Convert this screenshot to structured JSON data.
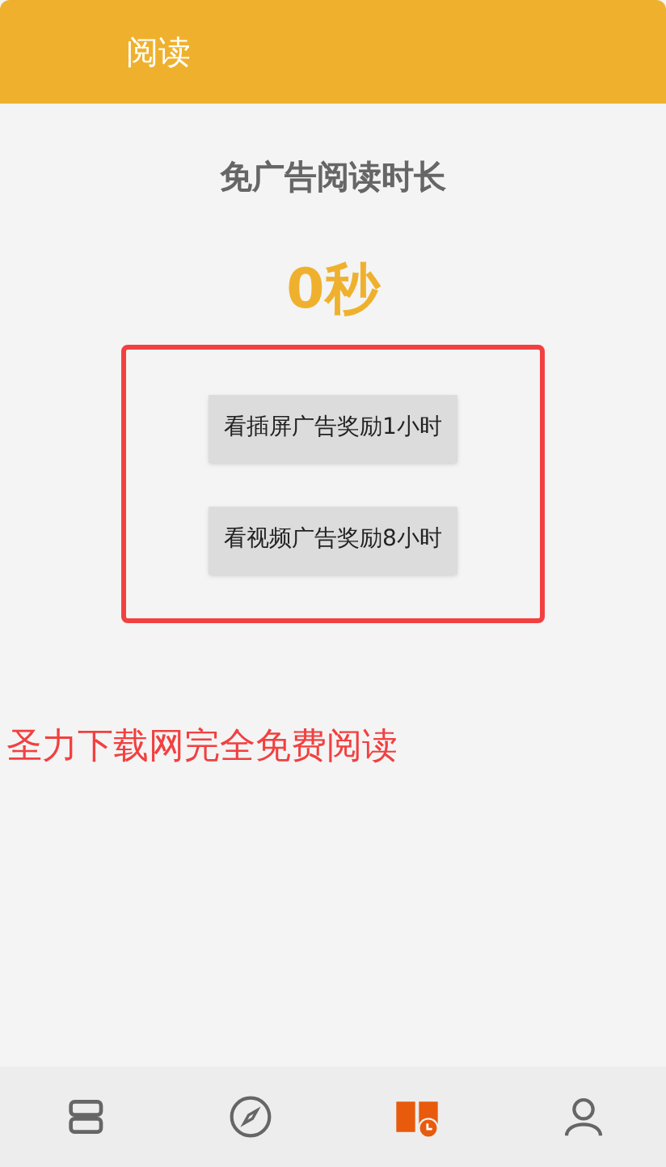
{
  "header": {
    "title": "阅读"
  },
  "heading": "免广告阅读时长",
  "duration": "0秒",
  "buttons": [
    "看插屏广告奖励1小时",
    "看视频广告奖励8小时"
  ],
  "notice": "圣力下载网完全免费阅读",
  "nav": [
    {
      "kind": "books",
      "selected": false
    },
    {
      "kind": "discover",
      "selected": false
    },
    {
      "kind": "timer",
      "selected": true
    },
    {
      "kind": "profile",
      "selected": false
    }
  ]
}
